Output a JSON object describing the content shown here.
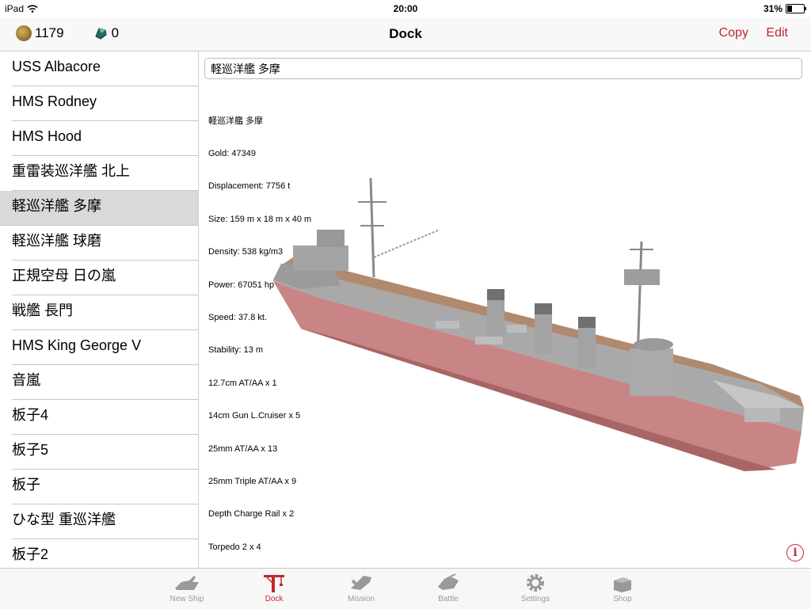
{
  "status": {
    "carrier": "iPad",
    "time": "20:00",
    "battery": "31%",
    "battery_level": 0.31
  },
  "resources": {
    "gold": "1179",
    "gems": "0"
  },
  "nav": {
    "title": "Dock",
    "copy_label": "Copy",
    "edit_label": "Edit"
  },
  "ships": [
    "USS Albacore",
    "HMS Rodney",
    "HMS Hood",
    "重雷装巡洋艦 北上",
    "軽巡洋艦 多摩",
    "軽巡洋艦 球磨",
    "正規空母 日の嵐",
    "戦艦 長門",
    "HMS King George V",
    "音嵐",
    "板子4",
    "板子5",
    "板子",
    "ひな型 重巡洋艦",
    "板子2"
  ],
  "selected_index": 4,
  "detail": {
    "name": "軽巡洋艦 多摩",
    "specs": [
      "軽巡洋艦 多摩",
      "Gold: 47349",
      "Displacement: 7756 t",
      "Size: 159 m x 18 m x 40 m",
      "Density: 538 kg/m3",
      "Power: 67051 hp",
      "Speed: 37.8 kt.",
      "Stability: 13 m",
      "12.7cm AT/AA x 1",
      "14cm Gun L.Cruiser x 5",
      "25mm AT/AA x 13",
      "25mm Triple AT/AA x 9",
      "Depth Charge Rail x 2",
      "Torpedo 2 x 4"
    ]
  },
  "tabs": [
    {
      "label": "New Ship",
      "icon": "new-ship-icon"
    },
    {
      "label": "Dock",
      "icon": "crane-icon"
    },
    {
      "label": "Mission",
      "icon": "mission-icon"
    },
    {
      "label": "Battle",
      "icon": "battle-icon"
    },
    {
      "label": "Settings",
      "icon": "gear-icon"
    },
    {
      "label": "Shop",
      "icon": "shop-icon"
    }
  ],
  "active_tab": 1,
  "colors": {
    "accent": "#c0272d",
    "inactive": "#999999",
    "selected_row": "#d9d9d9"
  }
}
